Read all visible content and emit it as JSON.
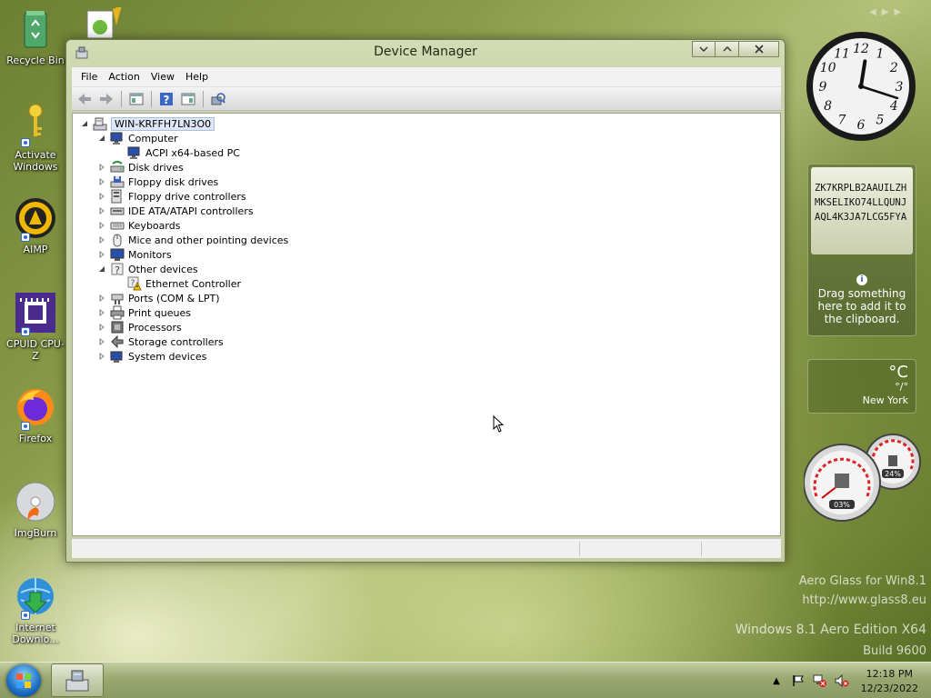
{
  "desktop": {
    "icons": [
      {
        "label": "Recycle Bin",
        "icon": "recycle-bin-icon"
      },
      {
        "label": "Activate Windows",
        "icon": "key-icon"
      },
      {
        "label": "AIMP",
        "icon": "aimp-icon"
      },
      {
        "label": "CPUID CPU-Z",
        "icon": "cpu-z-icon"
      },
      {
        "label": "Firefox",
        "icon": "firefox-icon"
      },
      {
        "label": "ImgBurn",
        "icon": "imgburn-icon"
      },
      {
        "label": "Internet Downlo...",
        "icon": "internet-download-manager-icon"
      }
    ]
  },
  "window": {
    "title": "Device Manager",
    "menu": [
      "File",
      "Action",
      "View",
      "Help"
    ],
    "toolbar_icons": [
      "back-icon",
      "forward-icon",
      "show-hide-tree-icon",
      "help-icon",
      "properties-icon",
      "scan-hardware-icon"
    ],
    "tree": {
      "root": "WIN-KRFFH7LN3O0",
      "nodes": [
        {
          "label": "Computer",
          "expanded": true,
          "children": [
            {
              "label": "ACPI x64-based PC"
            }
          ]
        },
        {
          "label": "Disk drives",
          "expanded": false
        },
        {
          "label": "Floppy disk drives",
          "expanded": false
        },
        {
          "label": "Floppy drive controllers",
          "expanded": false
        },
        {
          "label": "IDE ATA/ATAPI controllers",
          "expanded": false
        },
        {
          "label": "Keyboards",
          "expanded": false
        },
        {
          "label": "Mice and other pointing devices",
          "expanded": false
        },
        {
          "label": "Monitors",
          "expanded": false
        },
        {
          "label": "Other devices",
          "expanded": true,
          "children": [
            {
              "label": "Ethernet Controller",
              "warning": true
            }
          ]
        },
        {
          "label": "Ports (COM & LPT)",
          "expanded": false
        },
        {
          "label": "Print queues",
          "expanded": false
        },
        {
          "label": "Processors",
          "expanded": false
        },
        {
          "label": "Storage controllers",
          "expanded": false
        },
        {
          "label": "System devices",
          "expanded": false
        }
      ]
    }
  },
  "gadgets": {
    "clock": {
      "hour": 12,
      "minute": 18
    },
    "clipboard": {
      "text": "ZK7KRPLB2AAUILZHMKSELIKO74LLQUNJAQL4K3JA7LCG5FYA",
      "hint": "Drag something here to add it to the clipboard."
    },
    "weather": {
      "unit": "°C",
      "range": "°/°",
      "city": "New York"
    },
    "meter": {
      "cpu": "03%",
      "memory": "24%"
    }
  },
  "watermark": {
    "line1": "Aero Glass for Win8.1",
    "line2": "http://www.glass8.eu",
    "line3": "Windows 8.1 Aero Edition X64",
    "line4": "Build 9600"
  },
  "taskbar": {
    "time": "12:18 PM",
    "date": "12/23/2022",
    "colors": {
      "start": "#1c6fc4"
    }
  }
}
